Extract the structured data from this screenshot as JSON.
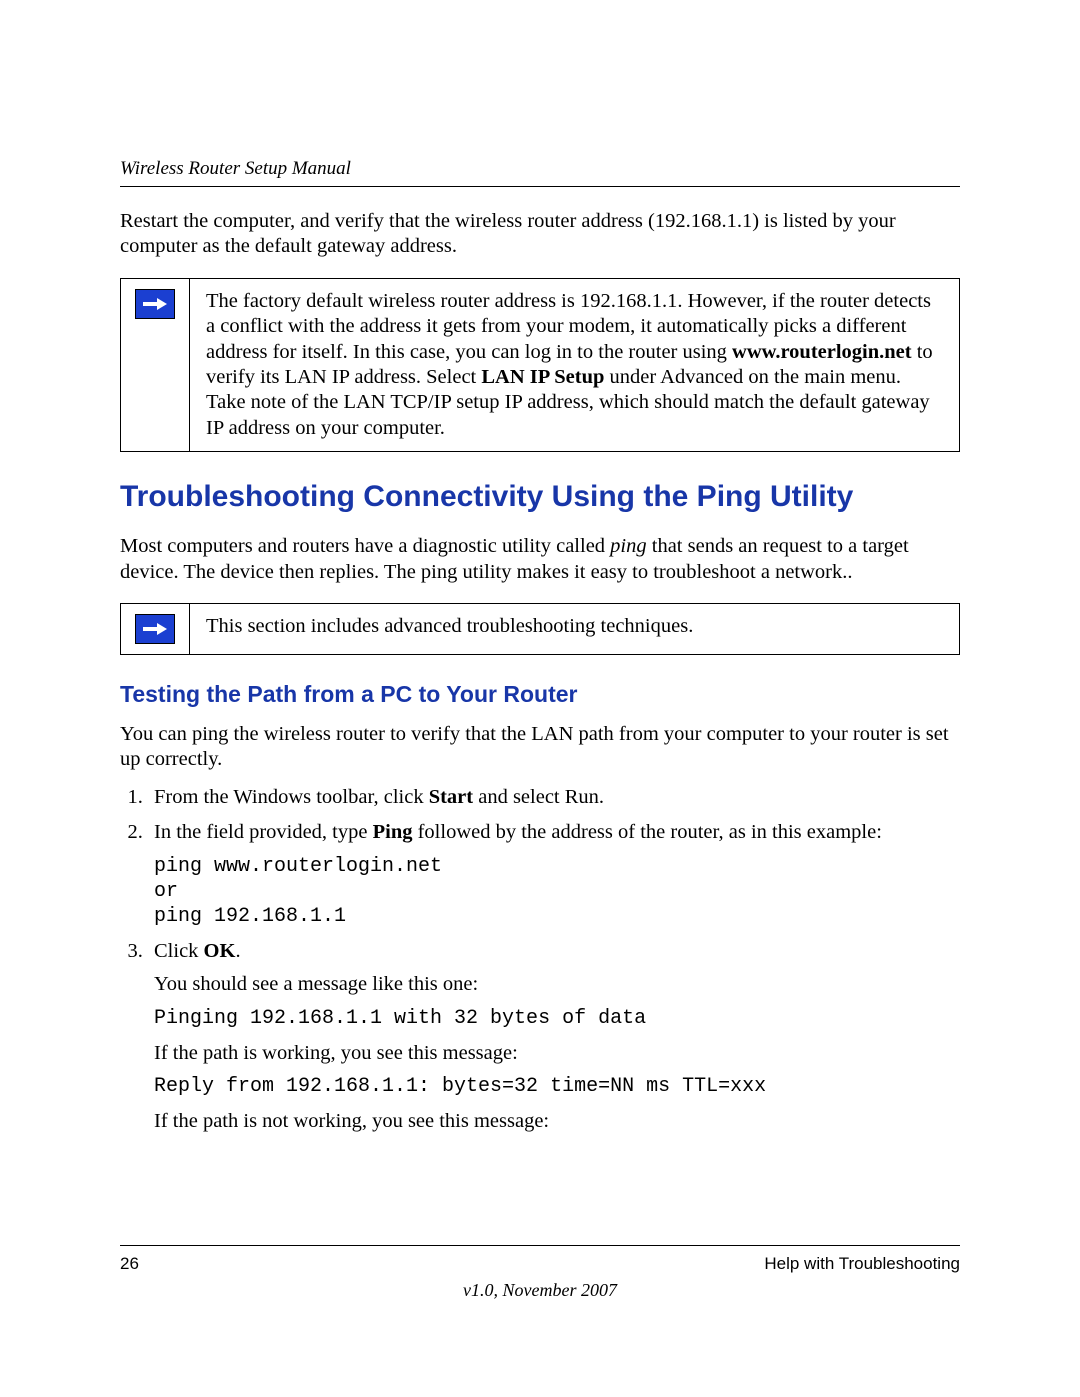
{
  "header": {
    "running": "Wireless Router Setup Manual"
  },
  "intro_para": "Restart the computer, and verify that the wireless router address (192.168.1.1) is listed by your computer as the default gateway address.",
  "note1": {
    "seg1": "The factory default wireless router address is 192.168.1.1. However, if the router detects a conflict with the address it gets from your modem, it automatically picks a different address for itself. In this case, you can log in to the router using ",
    "bold1": "www.routerlogin.net",
    "seg2": " to verify its LAN IP address. Select ",
    "bold2": "LAN IP Setup",
    "seg3": " under Advanced on the main menu. Take note of the LAN TCP/IP setup IP address, which should match the default gateway IP address on your computer."
  },
  "h1": "Troubleshooting Connectivity Using the Ping Utility",
  "ping_para": {
    "pre": "Most computers and routers have a diagnostic utility called ",
    "it": "ping",
    "post": " that sends an request to a target device. The device then replies. The ping utility makes it easy to troubleshoot a network.."
  },
  "note2": "This section includes advanced troubleshooting techniques.",
  "h2": "Testing the Path from a PC to Your Router",
  "testing_para": "You can ping the wireless router to verify that the LAN path from your computer to your router is set up correctly.",
  "steps": {
    "s1": {
      "pre": "From the Windows toolbar, click ",
      "bold": "Start",
      "post": " and select Run."
    },
    "s2": {
      "pre": "In the field provided, type ",
      "bold": "Ping",
      "post": " followed by the address of the router, as in this example:"
    },
    "s2_code": "ping www.routerlogin.net\nor\nping 192.168.1.1",
    "s3": {
      "pre": "Click ",
      "bold": "OK",
      "post": "."
    },
    "s3_p1": "You should see a message like this one:",
    "s3_code1": "Pinging 192.168.1.1 with 32 bytes of data",
    "s3_p2": "If the path is working, you see this message:",
    "s3_code2": "Reply from 192.168.1.1: bytes=32 time=NN ms TTL=xxx",
    "s3_p3": "If the path is not working, you see this message:"
  },
  "footer": {
    "page": "26",
    "chapter": "Help with Troubleshooting",
    "version": "v1.0, November 2007"
  }
}
